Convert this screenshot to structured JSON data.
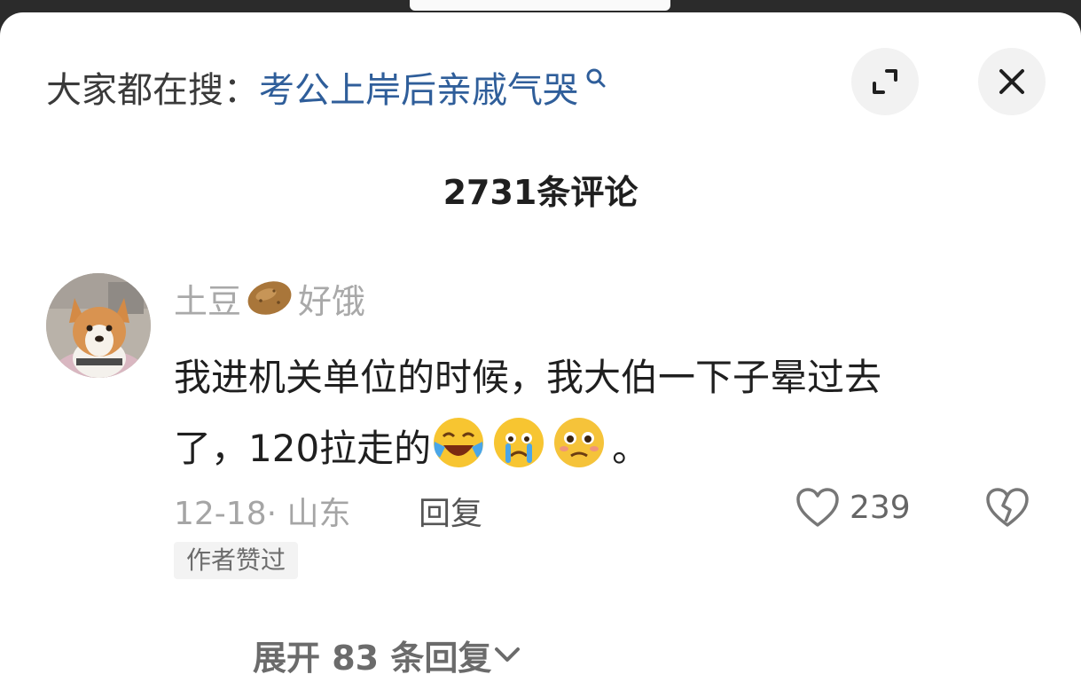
{
  "search": {
    "prefix": "大家都在搜：",
    "query": "考公上岸后亲戚气哭",
    "icon": "search-icon"
  },
  "header": {
    "expand_icon": "expand-icon",
    "close_icon": "close-icon"
  },
  "comments_header": {
    "count_text": "2731条评论"
  },
  "comment": {
    "username": "土豆",
    "username_suffix": "好饿",
    "avatar": "corgi-avatar",
    "text_line1": "我进机关单位的时候，我大伯一下子晕过去",
    "text_line2_a": "了，120拉走的",
    "text_line2_b": "。",
    "emojis": [
      "laughing-crying-emoji",
      "crying-emoji",
      "pleading-emoji"
    ],
    "time_location": "12-18· 山东",
    "reply_label": "回复",
    "like_count": "239",
    "author_badge": "作者赞过",
    "expand_replies": "展开 83 条回复"
  },
  "colors": {
    "search_query": "#2f5e9a",
    "username": "#a9a9a9",
    "body_text": "#1f1f1f"
  }
}
